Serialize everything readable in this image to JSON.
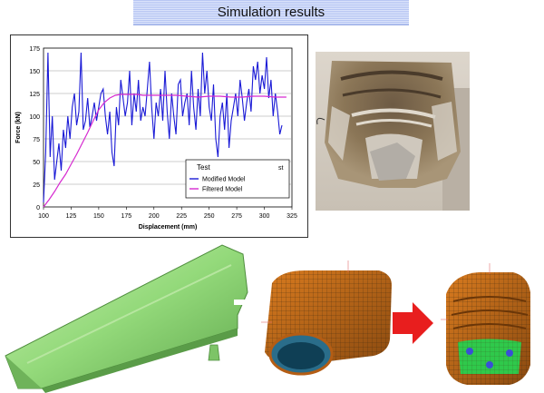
{
  "header": {
    "title": "Simulation results"
  },
  "chart_data": {
    "type": "line",
    "title": "",
    "xlabel": "Displacement (mm)",
    "ylabel": "Force (kN)",
    "xlim": [
      100,
      325
    ],
    "ylim": [
      0,
      175
    ],
    "xticks": [
      100,
      125,
      150,
      175,
      200,
      225,
      250,
      275,
      300,
      325
    ],
    "yticks": [
      0,
      25,
      50,
      75,
      100,
      125,
      150,
      175
    ],
    "grid": "horizontal",
    "legend_title": "Test",
    "legend_title_suffix": "st",
    "legend_position": "bottom-right",
    "series": [
      {
        "name": "Modified Model",
        "color": "#1a1ad6",
        "x": [
          100,
          102,
          104,
          106,
          108,
          110,
          112,
          114,
          116,
          118,
          120,
          122,
          124,
          126,
          128,
          130,
          132,
          134,
          136,
          138,
          140,
          142,
          144,
          146,
          148,
          150,
          152,
          154,
          156,
          158,
          160,
          162,
          164,
          166,
          168,
          170,
          172,
          174,
          176,
          178,
          180,
          182,
          184,
          186,
          188,
          190,
          192,
          194,
          196,
          198,
          200,
          202,
          204,
          206,
          208,
          210,
          212,
          214,
          216,
          218,
          220,
          222,
          224,
          226,
          228,
          230,
          232,
          234,
          236,
          238,
          240,
          242,
          244,
          246,
          248,
          250,
          252,
          254,
          256,
          258,
          260,
          262,
          264,
          266,
          268,
          270,
          272,
          274,
          276,
          278,
          280,
          282,
          284,
          286,
          288,
          290,
          292,
          294,
          296,
          298,
          300,
          302,
          304,
          306,
          308,
          310,
          312,
          314,
          316
        ],
        "y": [
          5,
          60,
          170,
          55,
          100,
          30,
          50,
          70,
          40,
          85,
          65,
          100,
          75,
          110,
          125,
          90,
          105,
          170,
          85,
          95,
          120,
          88,
          100,
          115,
          95,
          110,
          125,
          130,
          100,
          80,
          105,
          60,
          45,
          110,
          90,
          140,
          120,
          100,
          115,
          150,
          90,
          125,
          105,
          140,
          95,
          110,
          100,
          130,
          160,
          110,
          75,
          115,
          100,
          130,
          95,
          150,
          105,
          75,
          125,
          100,
          80,
          135,
          140,
          100,
          115,
          125,
          90,
          150,
          110,
          85,
          130,
          100,
          170,
          125,
          150,
          110,
          95,
          135,
          75,
          55,
          100,
          115,
          85,
          125,
          65,
          95,
          110,
          125,
          100,
          140,
          120,
          95,
          115,
          130,
          105,
          155,
          140,
          160,
          125,
          145,
          130,
          165,
          120,
          140,
          100,
          125,
          105,
          80,
          90
        ]
      },
      {
        "name": "Filtered Model",
        "color": "#d62ad0",
        "x": [
          100,
          105,
          110,
          115,
          120,
          125,
          130,
          135,
          140,
          145,
          150,
          155,
          160,
          165,
          170,
          175,
          180,
          185,
          190,
          195,
          200,
          210,
          220,
          230,
          240,
          250,
          260,
          270,
          280,
          290,
          300,
          310,
          320
        ],
        "y": [
          0,
          8,
          17,
          27,
          36,
          47,
          58,
          70,
          82,
          95,
          107,
          115,
          120,
          123,
          124,
          124,
          124,
          124,
          123,
          123,
          123,
          123,
          123,
          122,
          121,
          122,
          122,
          121,
          121,
          122,
          122,
          121,
          121
        ]
      }
    ]
  }
}
